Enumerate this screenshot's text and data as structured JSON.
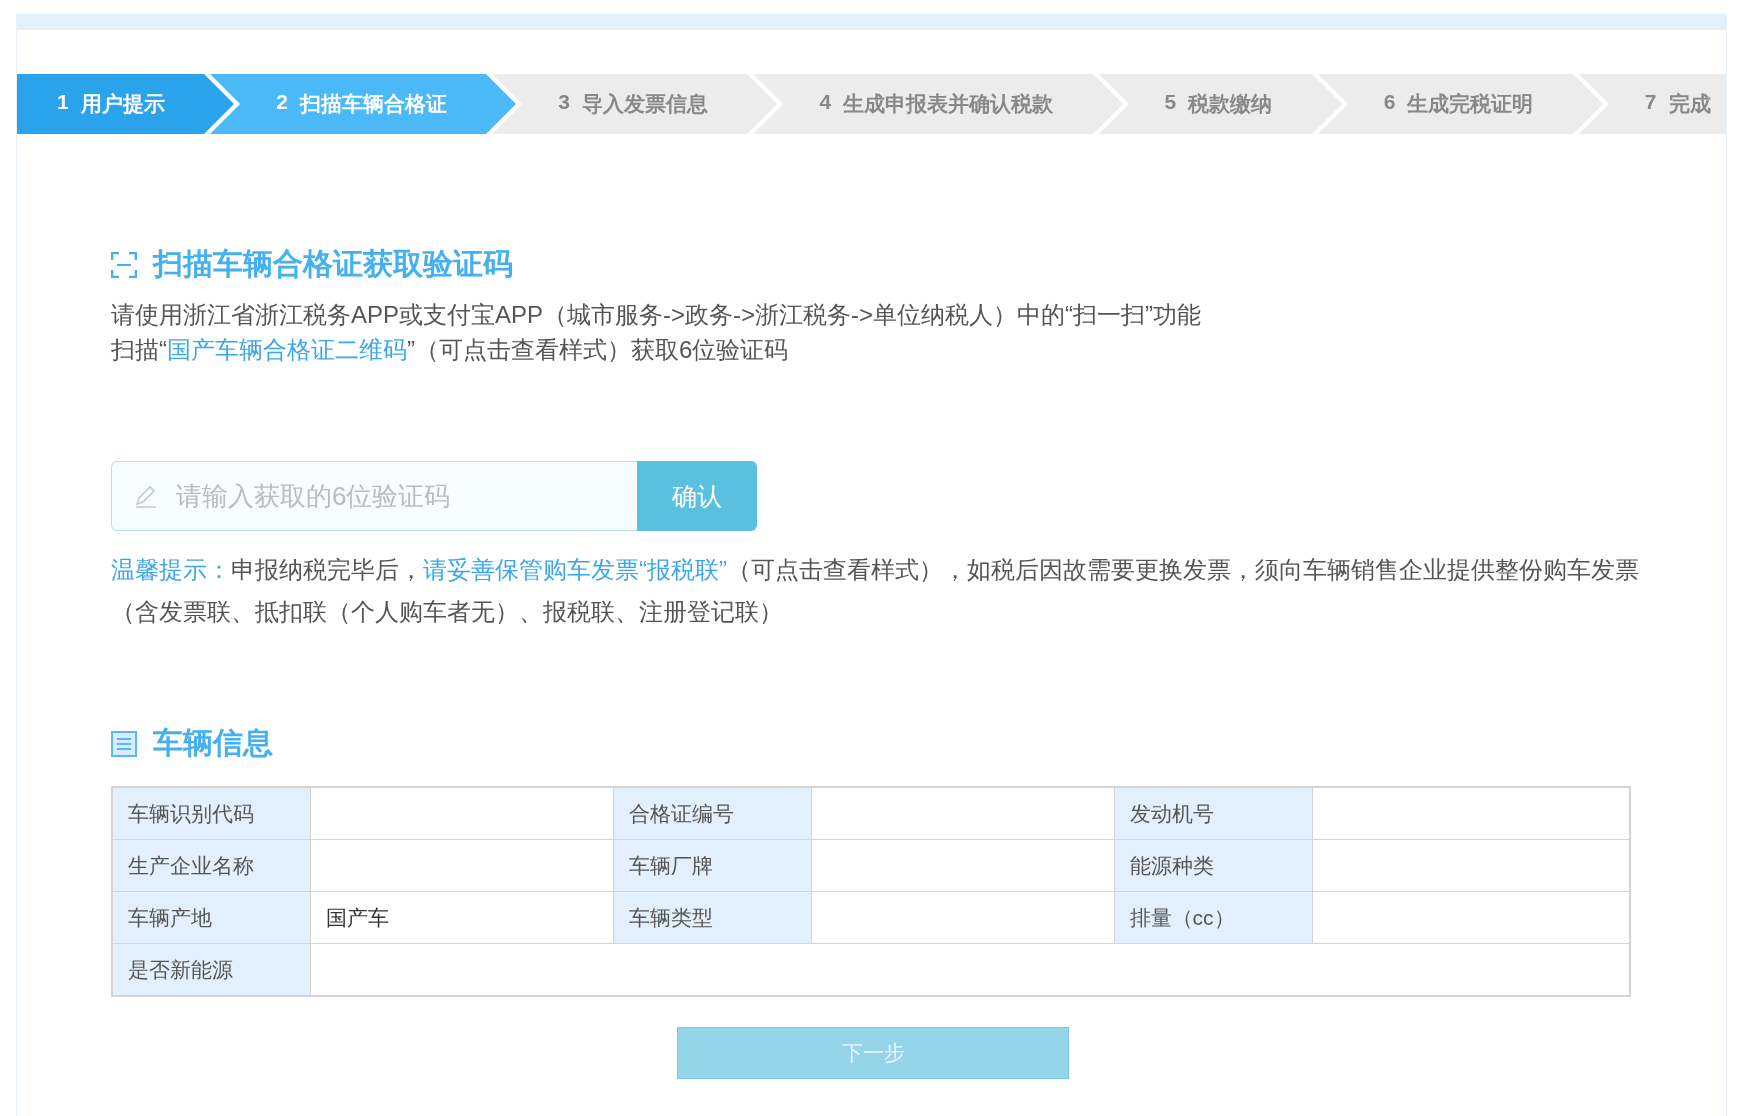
{
  "steps": [
    {
      "number": "1",
      "label": "用户提示",
      "completed": true,
      "selected": false
    },
    {
      "number": "2",
      "label": "扫描车辆合格证",
      "completed": false,
      "selected": true
    },
    {
      "number": "3",
      "label": "导入发票信息",
      "completed": false,
      "selected": false
    },
    {
      "number": "4",
      "label": "生成申报表并确认税款",
      "completed": false,
      "selected": false
    },
    {
      "number": "5",
      "label": "税款缴纳",
      "completed": false,
      "selected": false
    },
    {
      "number": "6",
      "label": "生成完税证明",
      "completed": false,
      "selected": false
    },
    {
      "number": "7",
      "label": "完成",
      "completed": false,
      "selected": false
    }
  ],
  "scan_section": {
    "title": "扫描车辆合格证获取验证码",
    "paragraphs": [
      [
        {
          "text": "请使用浙江省浙江税务APP或支付宝APP（城市服务->政务->浙江税务->单位纳税人）中的“扫一扫”功能",
          "kind": "plain"
        }
      ],
      [
        {
          "text": "扫描“",
          "kind": "plain"
        },
        {
          "text": "国产车辆合格证二维码",
          "kind": "link"
        },
        {
          "text": "”（可点击查看样式）获取6位验证码",
          "kind": "plain"
        }
      ]
    ],
    "code_field": {
      "placeholder": "请输入获取的6位验证码"
    },
    "confirm_button": "确认",
    "tip": [
      {
        "text": "温馨提示：",
        "kind": "label"
      },
      {
        "text": "申报纳税完毕后，",
        "kind": "plain"
      },
      {
        "text": "请妥善保管购车发票“报税联”",
        "kind": "link"
      },
      {
        "text": "（可点击查看样式），如税后因故需要更换发票，须向车辆销售企业提供整份购车发票（含发票联、抵扣联（个人购车者无）、报税联、注册登记联）",
        "kind": "plain"
      }
    ]
  },
  "vehicle_section": {
    "title": "车辆信息",
    "rows": [
      [
        {
          "label": "车辆识别代码"
        },
        {
          "label": "合格证编号"
        },
        {
          "label": "发动机号"
        }
      ],
      [
        {
          "label": "生产企业名称"
        },
        {
          "label": "车辆厂牌"
        },
        {
          "label": "能源种类"
        }
      ],
      [
        {
          "label": "车辆产地",
          "value": "国产车"
        },
        {
          "label": "车辆类型"
        },
        {
          "label": "排量（cc）"
        }
      ],
      [
        {
          "label": "是否新能源"
        }
      ]
    ]
  },
  "next_button": {
    "label": "下一步",
    "disabled": true
  }
}
